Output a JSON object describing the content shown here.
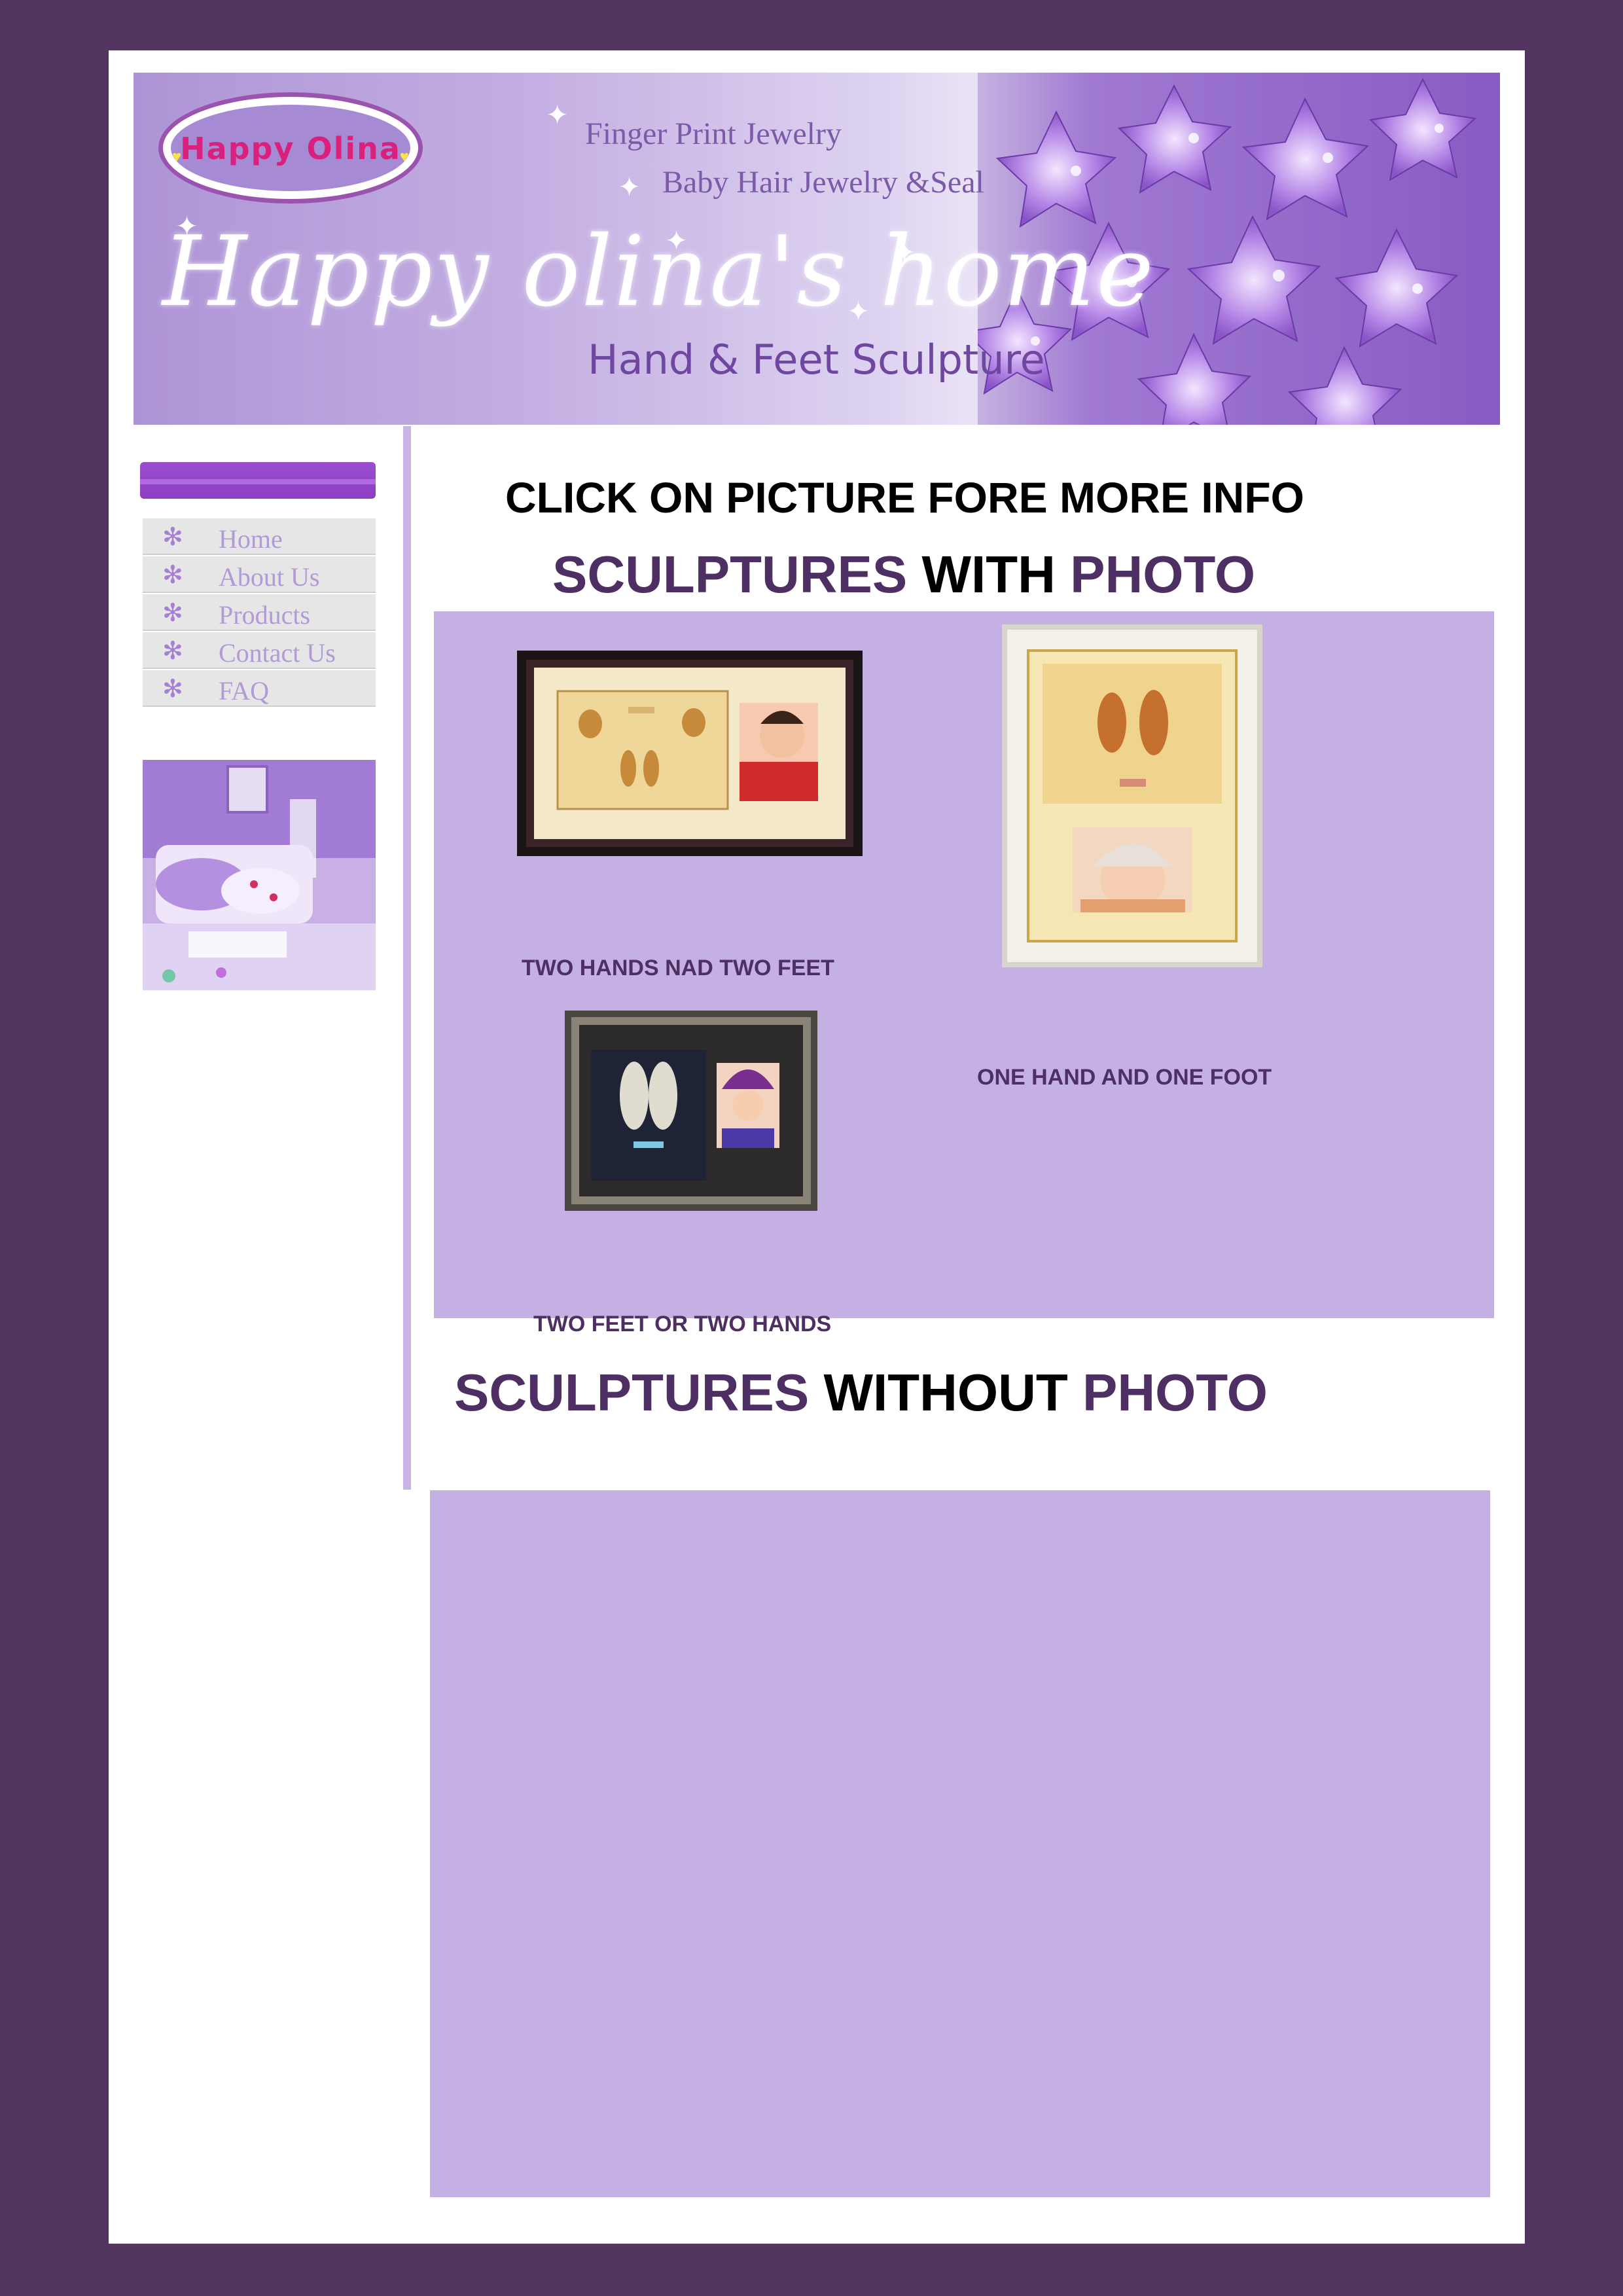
{
  "banner": {
    "logo_text": "Happy Olina",
    "tagline_1": "Finger Print Jewelry",
    "tagline_2": "Baby Hair Jewelry &Seal",
    "site_title": "Happy olina's home",
    "subtitle": "Hand & Feet Sculpture"
  },
  "sidebar": {
    "items": [
      {
        "label": "Home",
        "icon": "flower-bullet-icon"
      },
      {
        "label": "About Us",
        "icon": "flower-bullet-icon"
      },
      {
        "label": "Products",
        "icon": "flower-bullet-icon"
      },
      {
        "label": "Contact Us",
        "icon": "flower-bullet-icon"
      },
      {
        "label": "FAQ",
        "icon": "flower-bullet-icon"
      }
    ]
  },
  "main": {
    "click_info": "CLICK ON PICTURE FORE MORE INFO",
    "with_photo": {
      "part1": "SCULPTURES",
      "part2": "WITH",
      "part3": "PHOTO"
    },
    "without_photo": {
      "part1": "SCULPTURES",
      "part2": "WITHOUT",
      "part3": "PHOTO"
    },
    "products": [
      {
        "caption": "TWO HANDS NAD TWO FEET"
      },
      {
        "caption": "ONE HAND AND ONE FOOT"
      },
      {
        "caption": "TWO FEET OR TWO HANDS"
      }
    ]
  },
  "colors": {
    "page_background": "#523660",
    "panel": "#c4b0e2",
    "heading_purple": "#4d2f63",
    "accent": "#8c3dc0"
  }
}
